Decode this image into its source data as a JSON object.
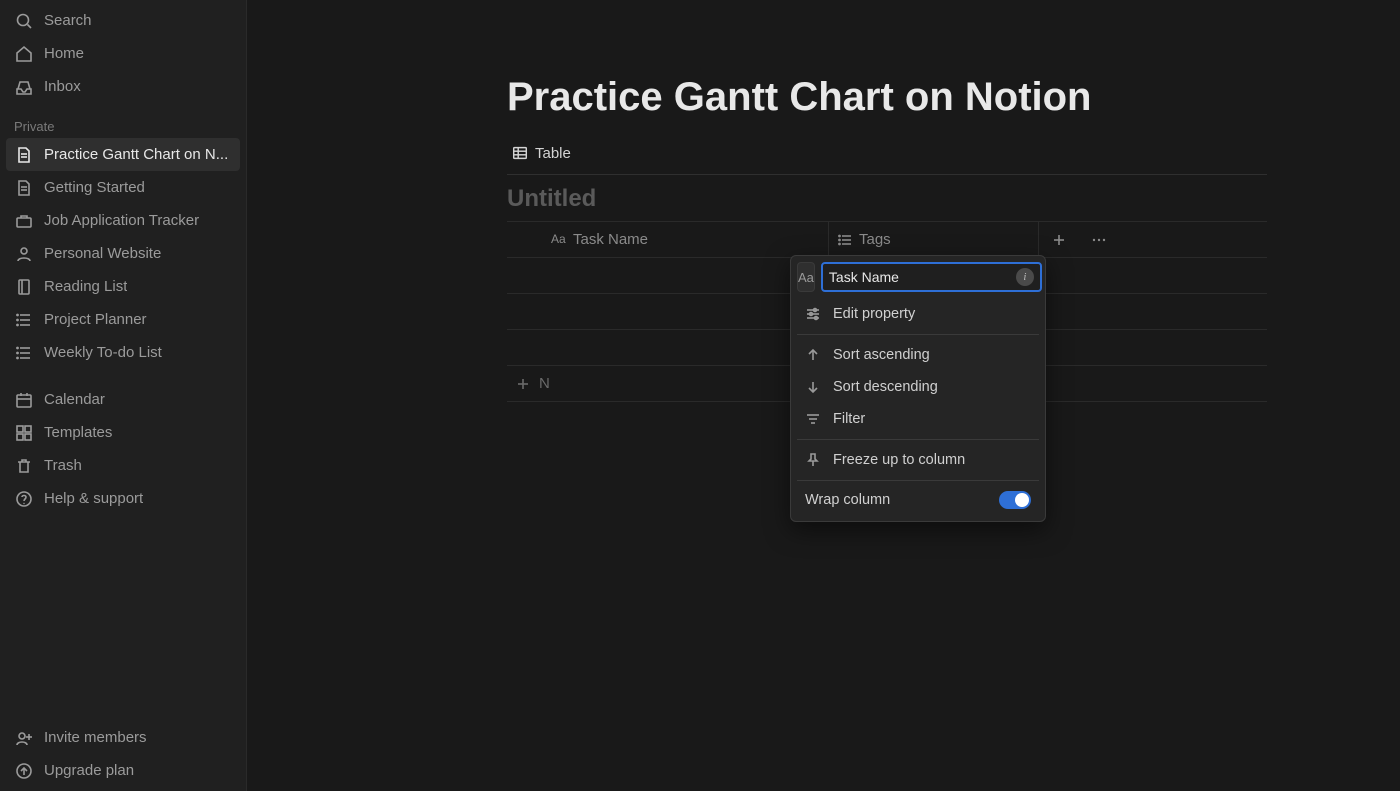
{
  "sidebar": {
    "top": [
      {
        "label": "Search",
        "icon": "search"
      },
      {
        "label": "Home",
        "icon": "home"
      },
      {
        "label": "Inbox",
        "icon": "inbox"
      }
    ],
    "section_label": "Private",
    "private": [
      {
        "label": "Practice Gantt Chart on N...",
        "icon": "page",
        "active": true
      },
      {
        "label": "Getting Started",
        "icon": "page"
      },
      {
        "label": "Job Application Tracker",
        "icon": "briefcase"
      },
      {
        "label": "Personal Website",
        "icon": "person"
      },
      {
        "label": "Reading List",
        "icon": "book"
      },
      {
        "label": "Project Planner",
        "icon": "list"
      },
      {
        "label": "Weekly To-do List",
        "icon": "list"
      }
    ],
    "tools": [
      {
        "label": "Calendar",
        "icon": "calendar"
      },
      {
        "label": "Templates",
        "icon": "templates"
      },
      {
        "label": "Trash",
        "icon": "trash"
      },
      {
        "label": "Help & support",
        "icon": "help"
      }
    ],
    "bottom": [
      {
        "label": "Invite members",
        "icon": "invite"
      },
      {
        "label": "Upgrade plan",
        "icon": "upgrade"
      }
    ]
  },
  "page": {
    "title": "Practice Gantt Chart on Notion",
    "view_label": "Table",
    "db_title": "Untitled",
    "columns": [
      {
        "label": "Task Name",
        "type": "title"
      },
      {
        "label": "Tags",
        "type": "multiselect"
      }
    ],
    "new_row_label": "N"
  },
  "popover": {
    "type_symbol": "Aa",
    "name_value": "Task Name",
    "edit_property": "Edit property",
    "sort_asc": "Sort ascending",
    "sort_desc": "Sort descending",
    "filter": "Filter",
    "freeze": "Freeze up to column",
    "wrap": "Wrap column",
    "wrap_on": true
  }
}
